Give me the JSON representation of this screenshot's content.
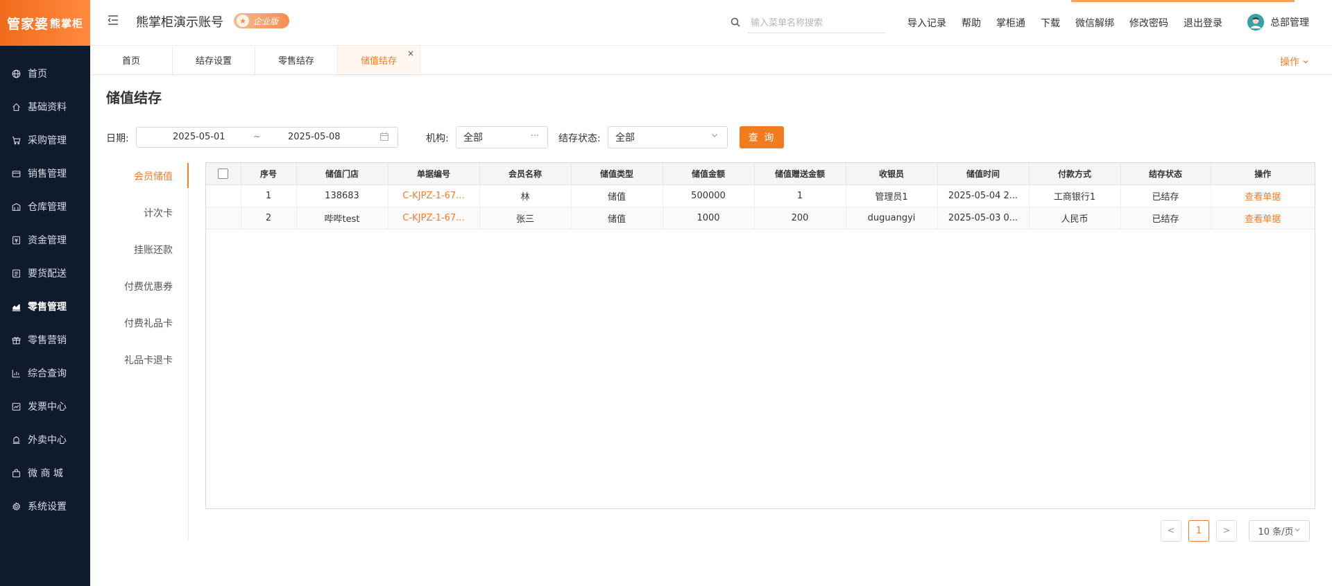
{
  "brand": {
    "logo_main": "管家婆",
    "logo_sub": "熊掌柜"
  },
  "sidebar": {
    "items": [
      {
        "label": "首页",
        "icon": "globe-icon"
      },
      {
        "label": "基础资料",
        "icon": "home-icon"
      },
      {
        "label": "采购管理",
        "icon": "cart-icon"
      },
      {
        "label": "销售管理",
        "icon": "wallet-icon"
      },
      {
        "label": "仓库管理",
        "icon": "warehouse-icon"
      },
      {
        "label": "资金管理",
        "icon": "money-icon"
      },
      {
        "label": "要货配送",
        "icon": "list-icon"
      },
      {
        "label": "零售管理",
        "icon": "chart-icon"
      },
      {
        "label": "零售营销",
        "icon": "gift-icon"
      },
      {
        "label": "综合查询",
        "icon": "bar-chart-icon"
      },
      {
        "label": "发票中心",
        "icon": "trend-icon"
      },
      {
        "label": "外卖中心",
        "icon": "bell-icon"
      },
      {
        "label": "微 商 城",
        "icon": "bag-icon"
      },
      {
        "label": "系统设置",
        "icon": "gear-icon"
      }
    ],
    "active_index": 7
  },
  "header": {
    "account_name": "熊掌柜演示账号",
    "edition": "企业版",
    "search_placeholder": "输入菜单名称搜索",
    "links": [
      "导入记录",
      "帮助",
      "掌柜通",
      "下载",
      "微信解绑",
      "修改密码",
      "退出登录"
    ],
    "user_name": "总部管理"
  },
  "tabs": {
    "items": [
      "首页",
      "结存设置",
      "零售结存",
      "储值结存"
    ],
    "active_index": 3,
    "close_glyph": "×",
    "ops_label": "操作"
  },
  "page": {
    "title": "储值结存"
  },
  "filters": {
    "date_label": "日期:",
    "date_start": "2025-05-01",
    "date_sep": "~",
    "date_end": "2025-05-08",
    "org_label": "机构:",
    "org_value": "全部",
    "status_label": "结存状态:",
    "status_value": "全部",
    "query_button": "查 询"
  },
  "subnav": {
    "items": [
      "会员储值",
      "计次卡",
      "挂账还款",
      "付费优惠券",
      "付费礼品卡",
      "礼品卡退卡"
    ],
    "active_index": 0
  },
  "table": {
    "columns": [
      "序号",
      "储值门店",
      "单据编号",
      "会员名称",
      "储值类型",
      "储值金额",
      "储值赠送金额",
      "收银员",
      "储值时间",
      "付款方式",
      "结存状态",
      "操作"
    ],
    "rows": [
      {
        "no": "1",
        "store": "138683",
        "bill": "C-KJPZ-1-67...",
        "member": "林",
        "type": "储值",
        "amount": "500000",
        "bonus": "1",
        "cashier": "管理员1",
        "time": "2025-05-04 2...",
        "pay": "工商银行1",
        "status": "已结存",
        "op": "查看单据"
      },
      {
        "no": "2",
        "store": "哔哔test",
        "bill": "C-KJPZ-1-67...",
        "member": "张三",
        "type": "储值",
        "amount": "1000",
        "bonus": "200",
        "cashier": "duguangyi",
        "time": "2025-05-03 0...",
        "pay": "人民币",
        "status": "已结存",
        "op": "查看单据"
      }
    ]
  },
  "pagination": {
    "prev": "<",
    "current": "1",
    "next": ">",
    "page_size": "10 条/页"
  },
  "colors": {
    "accent": "#f37b2b",
    "sidebar_bg": "#0f1b2d"
  }
}
